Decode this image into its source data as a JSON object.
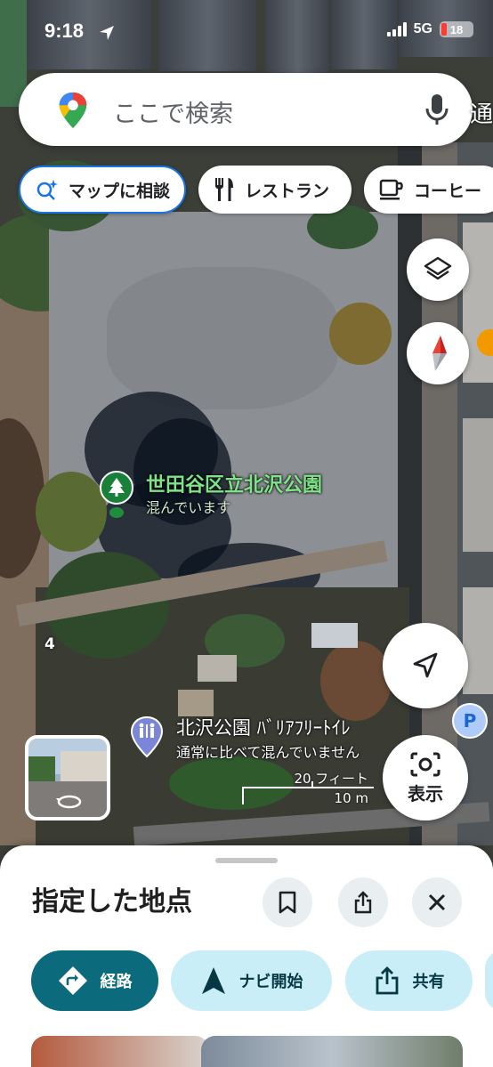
{
  "status_bar": {
    "time": "9:18",
    "network": "5G",
    "battery": "18"
  },
  "search": {
    "placeholder": "ここで検索",
    "edge_label": "通"
  },
  "chips": [
    {
      "label": "マップに相談",
      "icon": "sparkle-search-icon"
    },
    {
      "label": "レストラン",
      "icon": "fork-knife-icon"
    },
    {
      "label": "コーヒー",
      "icon": "coffee-cup-icon"
    }
  ],
  "map": {
    "park": {
      "name": "世田谷区立北沢公園",
      "status": "混んでいます"
    },
    "toilet": {
      "name": "北沢公園 ﾊﾞﾘｱﾌﾘｰﾄｲﾚ",
      "status": "通常に比べて混んでいません"
    },
    "road_number": "4",
    "scale": {
      "imperial": "20 フィート",
      "metric": "10 m"
    },
    "parking_label": "P"
  },
  "controls": {
    "lens_label": "表示"
  },
  "sheet": {
    "title": "指定した地点",
    "actions": [
      {
        "label": "経路",
        "icon": "directions-icon"
      },
      {
        "label": "ナビ開始",
        "icon": "navigation-arrow-icon"
      },
      {
        "label": "共有",
        "icon": "share-icon"
      }
    ]
  },
  "colors": {
    "primary_action": "#0b6b7c",
    "secondary_action": "#c9eef7",
    "park_label": "#7fe388",
    "accent_blue": "#1a73e8"
  }
}
